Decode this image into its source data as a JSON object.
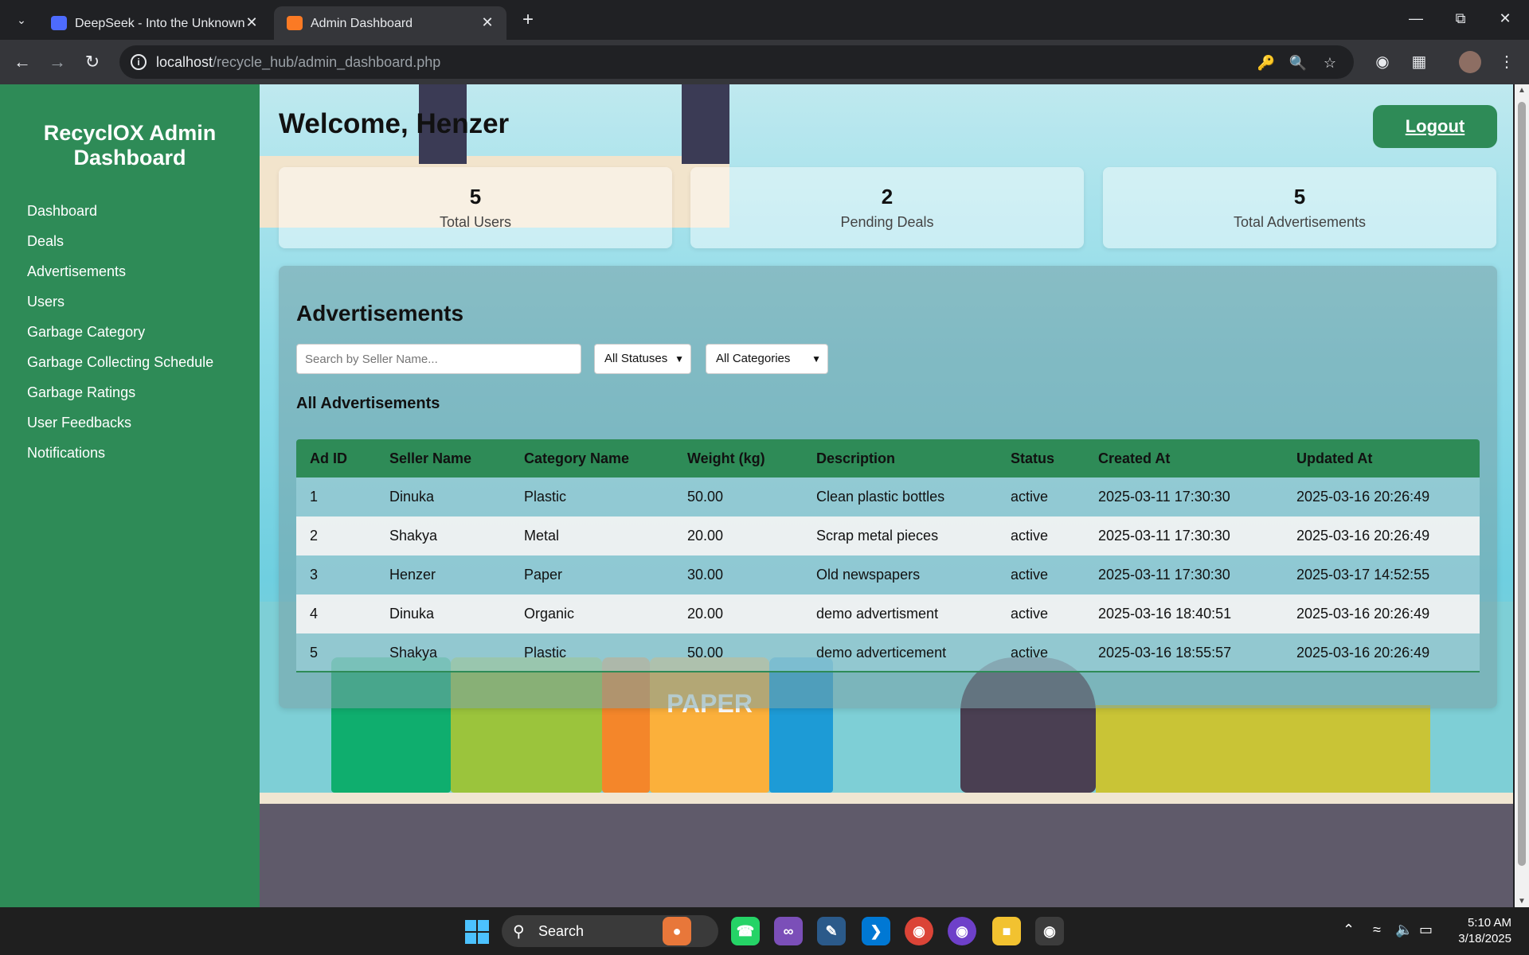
{
  "browser": {
    "tabs": [
      {
        "title": "DeepSeek - Into the Unknown",
        "favicon": "deepseek-whale-icon",
        "color": "#4d6bfe"
      },
      {
        "title": "Admin Dashboard",
        "favicon": "xampp-icon",
        "color": "#fb7a24"
      }
    ],
    "url_host": "localhost",
    "url_path": "/recycle_hub/admin_dashboard.php"
  },
  "sidebar": {
    "title": "RecyclOX Admin Dashboard",
    "items": [
      {
        "label": "Dashboard"
      },
      {
        "label": "Deals"
      },
      {
        "label": "Advertisements"
      },
      {
        "label": "Users"
      },
      {
        "label": "Garbage Category"
      },
      {
        "label": "Garbage Collecting Schedule"
      },
      {
        "label": "Garbage Ratings"
      },
      {
        "label": "User Feedbacks"
      },
      {
        "label": "Notifications"
      }
    ]
  },
  "header": {
    "welcome": "Welcome, Henzer",
    "logout": "Logout"
  },
  "stats": [
    {
      "value": "5",
      "label": "Total Users"
    },
    {
      "value": "2",
      "label": "Pending Deals"
    },
    {
      "value": "5",
      "label": "Total Advertisements"
    }
  ],
  "ads": {
    "title": "Advertisements",
    "search_placeholder": "Search by Seller Name...",
    "status_filter": "All Statuses",
    "category_filter": "All Categories",
    "subtitle": "All Advertisements",
    "columns": [
      "Ad ID",
      "Seller Name",
      "Category Name",
      "Weight (kg)",
      "Description",
      "Status",
      "Created At",
      "Updated At"
    ],
    "rows": [
      [
        "1",
        "Dinuka",
        "Plastic",
        "50.00",
        "Clean plastic bottles",
        "active",
        "2025-03-11 17:30:30",
        "2025-03-16 20:26:49"
      ],
      [
        "2",
        "Shakya",
        "Metal",
        "20.00",
        "Scrap metal pieces",
        "active",
        "2025-03-11 17:30:30",
        "2025-03-16 20:26:49"
      ],
      [
        "3",
        "Henzer",
        "Paper",
        "30.00",
        "Old newspapers",
        "active",
        "2025-03-11 17:30:30",
        "2025-03-17 14:52:55"
      ],
      [
        "4",
        "Dinuka",
        "Organic",
        "20.00",
        "demo advertisment",
        "active",
        "2025-03-16 18:40:51",
        "2025-03-16 20:26:49"
      ],
      [
        "5",
        "Shakya",
        "Plastic",
        "50.00",
        "demo adverticement",
        "active",
        "2025-03-16 18:55:57",
        "2025-03-16 20:26:49"
      ]
    ]
  },
  "background": {
    "bin_label": "PAPER"
  },
  "taskbar": {
    "search_label": "Search",
    "time": "5:10 AM",
    "date": "3/18/2025"
  },
  "colors": {
    "brand_green": "#2e8b57",
    "browser_dark": "#202124",
    "toolbar": "#35363a"
  }
}
